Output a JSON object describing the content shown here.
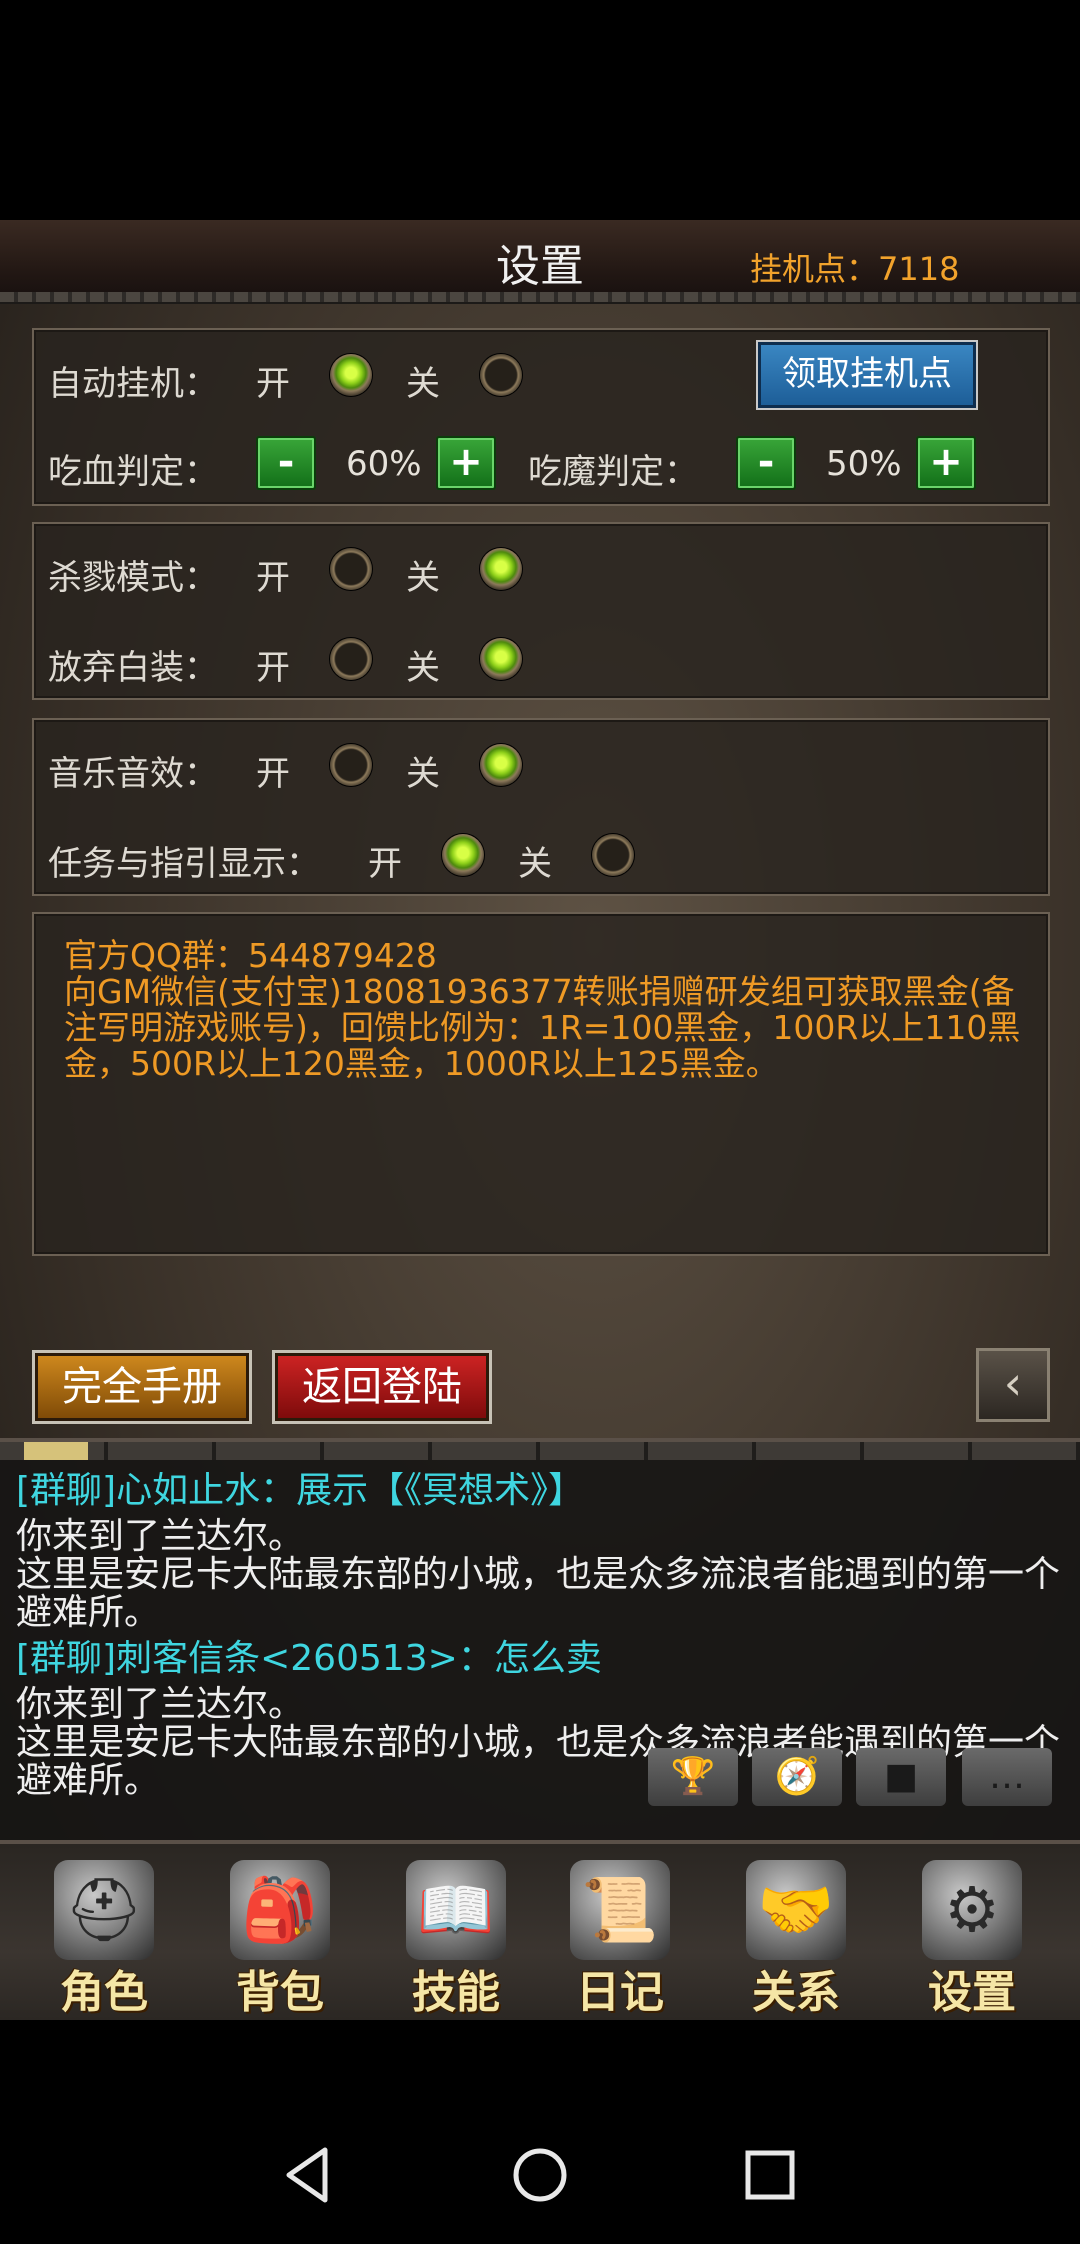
{
  "header": {
    "title": "设置",
    "points_label": "挂机点：7118"
  },
  "auto_panel": {
    "auto_label": "自动挂机：",
    "on": "开",
    "off": "关",
    "auto_state": "on",
    "claim_button": "领取挂机点",
    "hp_label": "吃血判定：",
    "hp_value": "60%",
    "mp_label": "吃魔判定：",
    "mp_value": "50%",
    "minus": "-",
    "plus": "+"
  },
  "combat_panel": {
    "kill_label": "杀戮模式：",
    "kill_state": "off",
    "drop_label": "放弃白装：",
    "drop_state": "off"
  },
  "sound_panel": {
    "music_label": "音乐音效：",
    "music_state": "off",
    "guide_label": "任务与指引显示：",
    "guide_state": "on"
  },
  "notice": {
    "text": "官方QQ群：544879428\n向GM微信(支付宝)18081936377转账捐赠研发组可获取黑金(备注写明游戏账号)，回馈比例为：1R=100黑金，100R以上110黑金，500R以上120黑金，1000R以上125黑金。"
  },
  "buttons": {
    "manual": "完全手册",
    "relogin": "返回登陆",
    "back_icon": "‹"
  },
  "chat": {
    "lines": [
      {
        "kind": "group",
        "text": "[群聊]心如止水：展示【《冥想术》】"
      },
      {
        "kind": "system",
        "text": "你来到了兰达尔。\n这里是安尼卡大陆最东部的小城，也是众多流浪者能遇到的第一个避难所。"
      },
      {
        "kind": "group",
        "text": "[群聊]刺客信条<260513>：怎么卖"
      },
      {
        "kind": "system",
        "text": "你来到了兰达尔。\n这里是安尼卡大陆最东部的小城，也是众多流浪者能遇到的第一个避难所。"
      },
      {
        "kind": "group",
        "text": "[群聊]刺客信条<260513>：怎么卖"
      }
    ],
    "icons": [
      {
        "name": "trophy-icon",
        "glyph": "🏆"
      },
      {
        "name": "compass-icon",
        "glyph": "🧭"
      },
      {
        "name": "stop-icon",
        "glyph": "■"
      },
      {
        "name": "chat-bubble-icon",
        "glyph": "…"
      }
    ]
  },
  "nav": [
    {
      "name": "nav-role",
      "label": "角色",
      "icon": "helmet-icon",
      "glyph": "⛑"
    },
    {
      "name": "nav-bag",
      "label": "背包",
      "icon": "backpack-icon",
      "glyph": "🎒"
    },
    {
      "name": "nav-skills",
      "label": "技能",
      "icon": "spellbook-icon",
      "glyph": "📖"
    },
    {
      "name": "nav-diary",
      "label": "日记",
      "icon": "scroll-icon",
      "glyph": "📜"
    },
    {
      "name": "nav-relations",
      "label": "关系",
      "icon": "handshake-icon",
      "glyph": "🤝"
    },
    {
      "name": "nav-settings",
      "label": "设置",
      "icon": "gear-icon",
      "glyph": "⚙"
    }
  ]
}
